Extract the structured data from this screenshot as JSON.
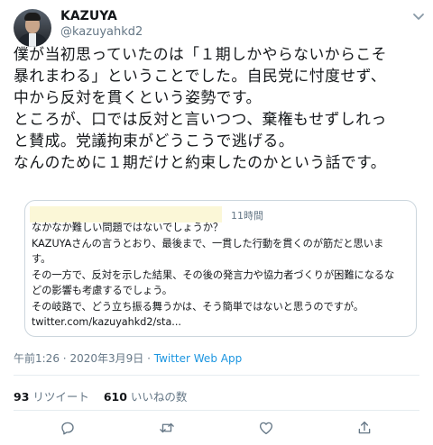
{
  "author": {
    "name": "KAZUYA",
    "handle": "@kazuyahkd2"
  },
  "tweet": {
    "lines": [
      "僕が当初思っていたのは「１期しかやらないからこそ",
      "暴れまわる」ということでした。自民党に忖度せず、",
      "中から反対を貫くという姿勢です。",
      "ところが、口では反対と言いつつ、棄権もせずしれっ",
      "と賛成。党議拘束がどうこうで逃げる。",
      "なんのために１期だけと約束したのかという話です。"
    ]
  },
  "quoted": {
    "time": "11時間",
    "lines": [
      "なかなか難しい問題ではないでしょうか？",
      "KAZUYAさんの言うとおり、最後まで、一貫した行動を貫くのが筋だと思いま",
      "す。",
      "その一方で、反対を示した結果、その後の発言力や協力者づくりが困難になるな",
      "どの影響も考慮するでしょう。",
      "その岐路で、どう立ち振る舞うかは、そう簡単ではないと思うのですが。",
      "twitter.com/kazuyahkd2/sta..."
    ]
  },
  "meta": {
    "time": "午前1:26",
    "separator": "·",
    "date": "2020年3月9日",
    "app": "Twitter Web App"
  },
  "stats": {
    "retweets_count": "93",
    "retweets_label": "リツイート",
    "likes_count": "610",
    "likes_label": "いいねの数"
  },
  "icons": {
    "menu": "chevron-down-icon",
    "reply": "reply-icon",
    "retweet": "retweet-icon",
    "like": "heart-icon",
    "share": "share-icon"
  },
  "colors": {
    "text": "#14171a",
    "muted": "#657786",
    "link": "#1b95e0",
    "border": "#ccd6dd",
    "divider": "#e6ecf0",
    "redaction": "#fbf7d7"
  }
}
